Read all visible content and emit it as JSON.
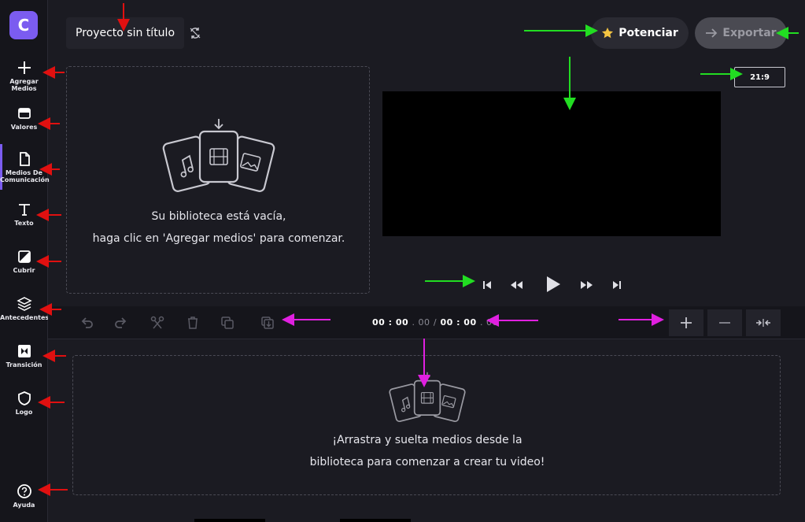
{
  "app": {
    "logo_letter": "C",
    "accent": "#7b5cf0"
  },
  "sidebar": {
    "items": [
      {
        "label": "Agregar Medios",
        "icon": "plus-icon"
      },
      {
        "label": "Valores",
        "icon": "store-icon"
      },
      {
        "label": "Medios De Comunicación",
        "icon": "file-icon"
      },
      {
        "label": "Texto",
        "icon": "text-icon"
      },
      {
        "label": "Cubrir",
        "icon": "overlay-icon"
      },
      {
        "label": "Antecedentes",
        "icon": "layers-icon"
      },
      {
        "label": "Transición",
        "icon": "transition-icon"
      },
      {
        "label": "Logo",
        "icon": "shield-icon"
      },
      {
        "label": "Ayuda",
        "icon": "help-icon"
      }
    ]
  },
  "header": {
    "project_title": "Proyecto sin título",
    "potenciar_label": "Potenciar",
    "exportar_label": "Exportar",
    "aspect_ratio": "21:9"
  },
  "library": {
    "empty_line1": "Su biblioteca está vacía,",
    "empty_line2": "haga clic en 'Agregar medios' para comenzar."
  },
  "timeline": {
    "current_time_main": "00 : 00",
    "current_time_frac": ". 00",
    "separator": "/",
    "total_time_main": "00 : 00",
    "total_time_frac": ". 00",
    "drop_line1": "¡Arrastra y suelta medios desde la",
    "drop_line2": "biblioteca para comenzar a crear tu video!"
  }
}
